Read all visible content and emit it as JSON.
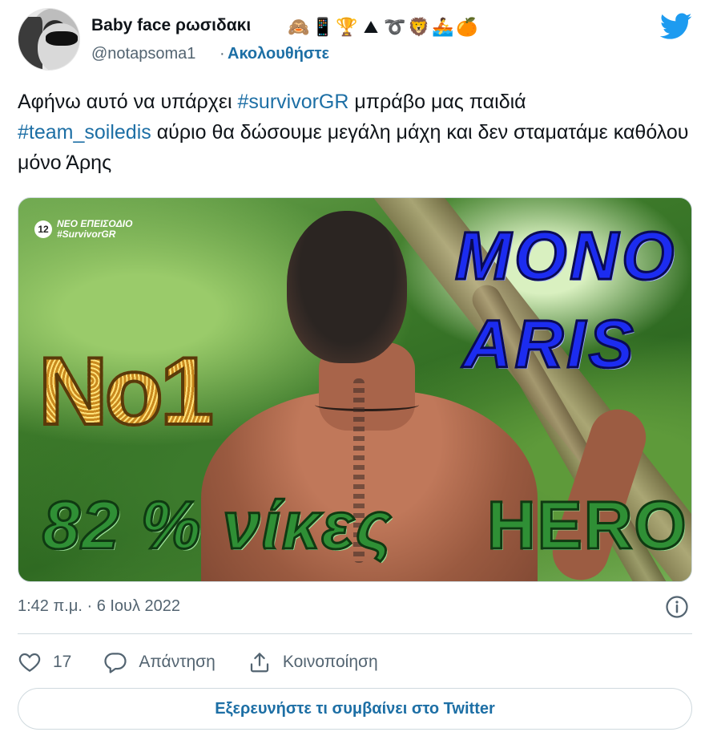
{
  "author": {
    "display_name": "Baby face ρωσιδακι",
    "emojis": [
      "🙈",
      "📱",
      "🏆",
      "⛰",
      "➰",
      "🦁",
      "🚣",
      "🍊"
    ],
    "handle": "@notapsoma1",
    "separator": "·",
    "follow_label": "Ακολουθήστε"
  },
  "tweet": {
    "text_segments": [
      {
        "text": "Αφήνω αυτό να υπάρχει ",
        "type": "text"
      },
      {
        "text": "#survivorGR",
        "type": "hashtag"
      },
      {
        "text": " μπράβο μας παιδιά ",
        "type": "text"
      },
      {
        "text": "#team_soiledis",
        "type": "hashtag"
      },
      {
        "text": " αύριο θα δώσουμε μεγάλη μάχη και δεν σταματάμε καθόλου μόνο Άρης",
        "type": "text"
      }
    ]
  },
  "media": {
    "channel_number": "12",
    "channel_line1": "ΝΕΟ ΕΠΕΙΣΟΔΙΟ",
    "channel_line2": "#SurvivorGR",
    "overlay_mono": "MONO",
    "overlay_aris": "ARIS",
    "overlay_no1": "No1",
    "overlay_victories": "82 % νίκες",
    "overlay_hero": "HERO"
  },
  "meta": {
    "timestamp": "1:42 π.μ. · 6 Ιουλ 2022"
  },
  "actions": {
    "like_count": "17",
    "reply_label": "Απάντηση",
    "share_label": "Κοινοποίηση"
  },
  "explore": {
    "label": "Εξερευνήστε τι συμβαίνει στο Twitter"
  },
  "colors": {
    "link": "#1d6fa5",
    "secondary_text": "#536471",
    "twitter_blue": "#1d9bf0",
    "border": "#cfd9de"
  },
  "icons": {
    "twitter": "twitter-bird-icon",
    "info": "info-icon",
    "like": "heart-icon",
    "reply": "reply-bubble-icon",
    "share": "share-upload-icon"
  }
}
